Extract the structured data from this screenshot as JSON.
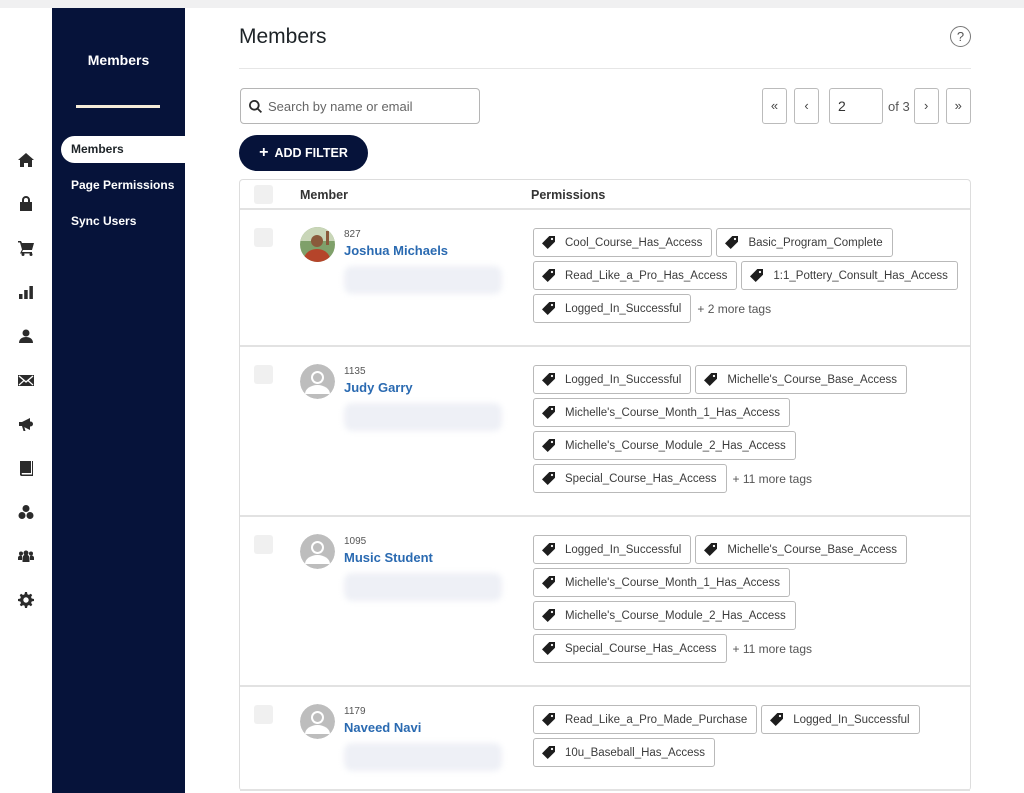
{
  "rail_icons": [
    "home-icon",
    "store-icon",
    "cart-icon",
    "reports-icon",
    "contacts-icon",
    "email-icon",
    "campaigns-icon",
    "courses-icon",
    "groups-icon",
    "community-icon",
    "settings-icon"
  ],
  "subnav": {
    "title": "Members",
    "items": [
      {
        "label": "Members",
        "active": true
      },
      {
        "label": "Page Permissions",
        "active": false
      },
      {
        "label": "Sync Users",
        "active": false
      }
    ]
  },
  "header": {
    "title": "Members",
    "help": "?"
  },
  "search": {
    "placeholder": "Search by name or email",
    "value": ""
  },
  "pagination": {
    "first": "«",
    "prev": "‹",
    "current": "2",
    "of_label": "of 3",
    "next": "›",
    "last": "»"
  },
  "add_filter_label": "ADD FILTER",
  "table": {
    "columns": {
      "member": "Member",
      "permissions": "Permissions"
    },
    "rows": [
      {
        "id": "827",
        "name": "Joshua Michaels",
        "avatar": "photo",
        "tags": [
          "Cool_Course_Has_Access",
          "Basic_Program_Complete",
          "Read_Like_a_Pro_Has_Access",
          "1:1_Pottery_Consult_Has_Access",
          "Logged_In_Successful"
        ],
        "more": "+ 2 more tags"
      },
      {
        "id": "1135",
        "name": "Judy Garry",
        "avatar": "default",
        "tags": [
          "Logged_In_Successful",
          "Michelle's_Course_Base_Access",
          "Michelle's_Course_Month_1_Has_Access",
          "Michelle's_Course_Module_2_Has_Access",
          "Special_Course_Has_Access"
        ],
        "more": "+ 11 more tags"
      },
      {
        "id": "1095",
        "name": "Music Student",
        "avatar": "default",
        "tags": [
          "Logged_In_Successful",
          "Michelle's_Course_Base_Access",
          "Michelle's_Course_Month_1_Has_Access",
          "Michelle's_Course_Module_2_Has_Access",
          "Special_Course_Has_Access"
        ],
        "more": "+ 11 more tags"
      },
      {
        "id": "1179",
        "name": "Naveed Navi",
        "avatar": "default",
        "tags": [
          "Read_Like_a_Pro_Made_Purchase",
          "Logged_In_Successful",
          "10u_Baseball_Has_Access"
        ],
        "more": ""
      }
    ]
  }
}
